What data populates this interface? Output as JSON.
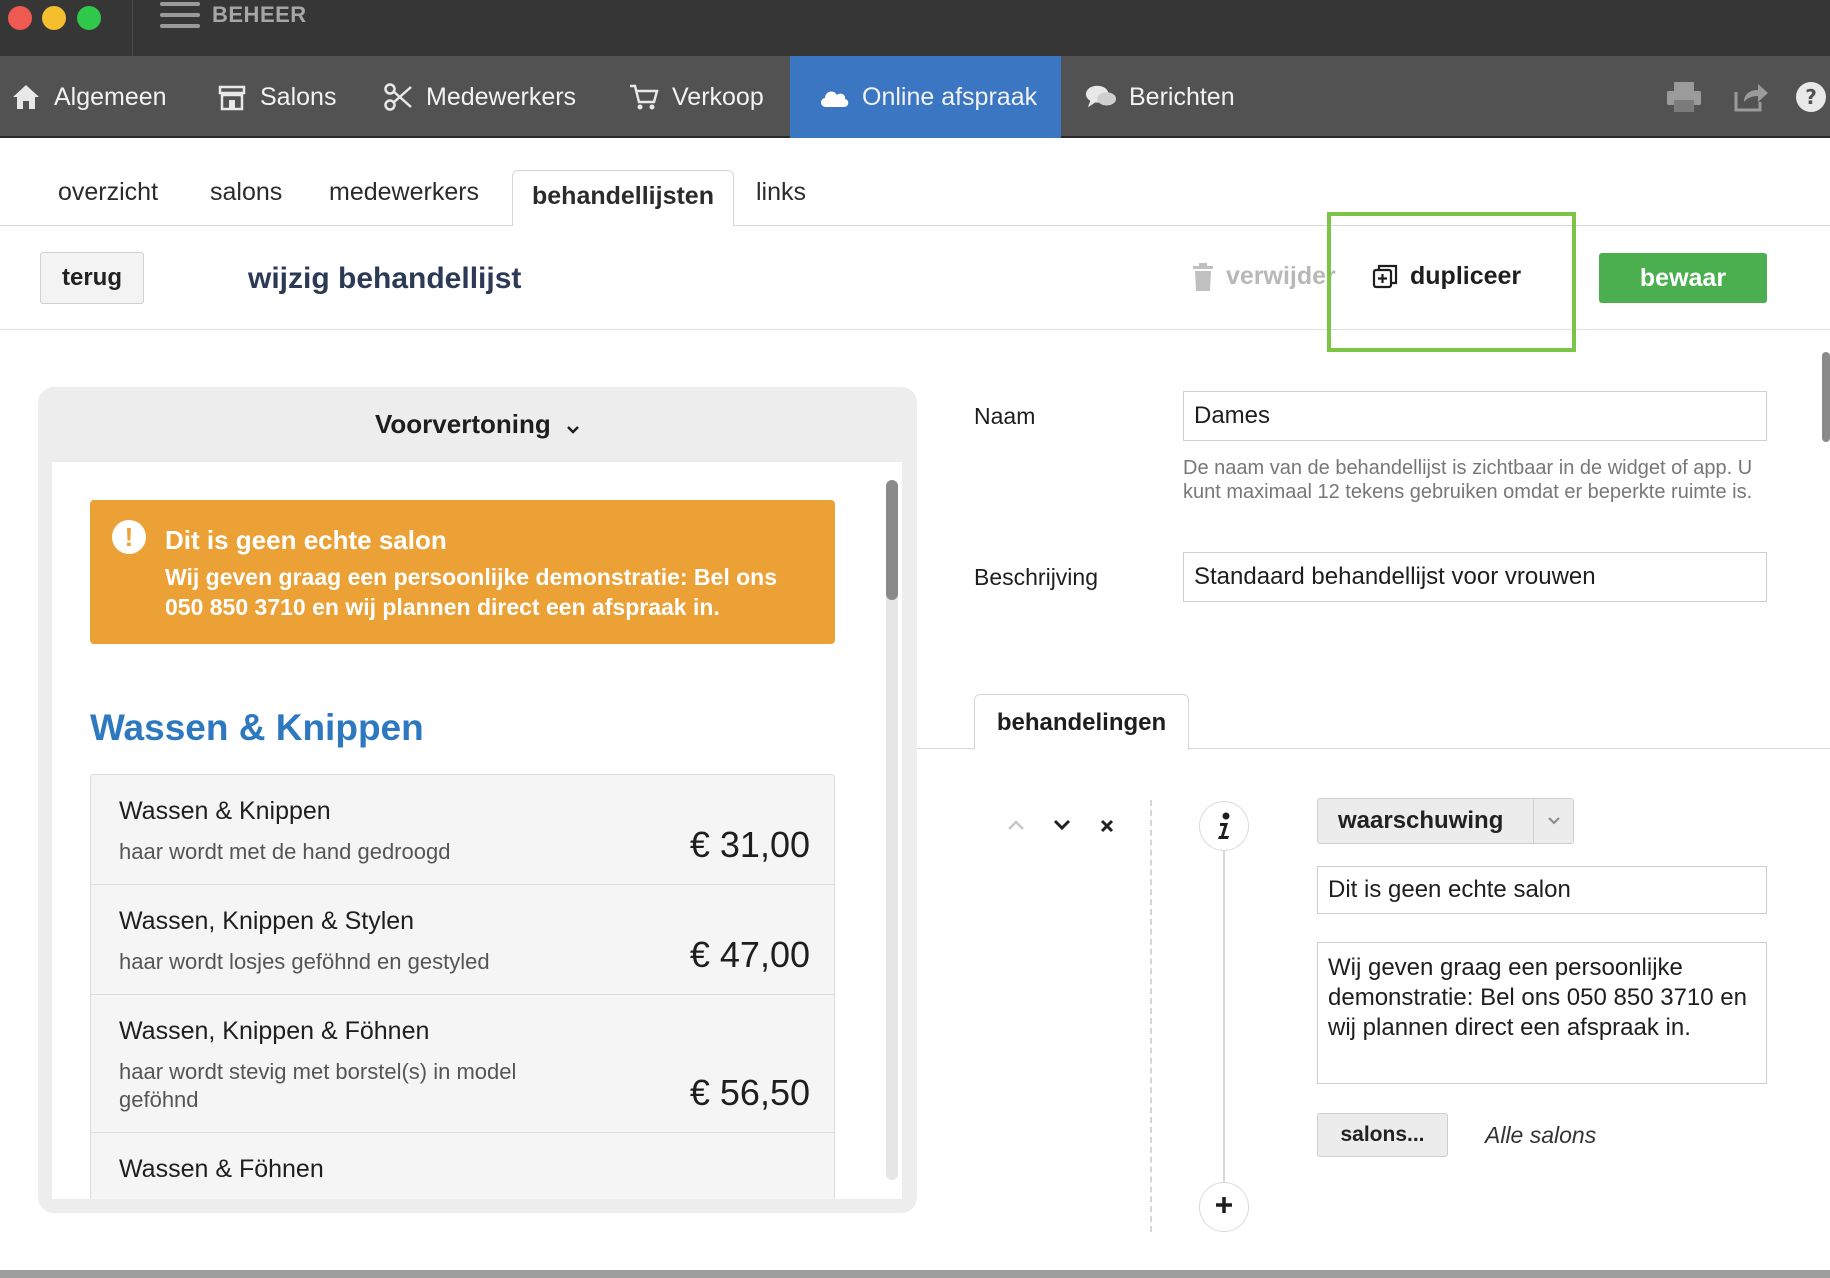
{
  "app": {
    "title": "BEHEER"
  },
  "mainnav": {
    "items": [
      {
        "label": "Algemeen",
        "icon": "home-icon"
      },
      {
        "label": "Salons",
        "icon": "store-icon"
      },
      {
        "label": "Medewerkers",
        "icon": "scissors-icon"
      },
      {
        "label": "Verkoop",
        "icon": "cart-icon"
      },
      {
        "label": "Online afspraak",
        "icon": "cloud-icon",
        "active": true
      },
      {
        "label": "Berichten",
        "icon": "chat-icon"
      }
    ],
    "active_color": "#3b76c2"
  },
  "subtabs": {
    "items": [
      "overzicht",
      "salons",
      "medewerkers",
      "behandellijsten",
      "links"
    ],
    "active": "behandellijsten"
  },
  "toolbar": {
    "back_label": "terug",
    "page_title": "wijzig behandellijst",
    "delete_label": "verwijder",
    "duplicate_label": "dupliceer",
    "save_label": "bewaar",
    "save_color": "#4bae4f",
    "highlight_color": "#7cc446"
  },
  "preview": {
    "header": "Voorvertoning",
    "alert": {
      "title": "Dit is geen echte salon",
      "text": "Wij geven graag een persoonlijke demonstratie: Bel ons 050 850 3710 en wij plannen direct een afspraak in.",
      "color": "#eba136"
    },
    "section_title": "Wassen & Knippen",
    "services": [
      {
        "name": "Wassen & Knippen",
        "desc": "haar wordt met de hand gedroogd",
        "price": "€ 31,00"
      },
      {
        "name": "Wassen, Knippen & Stylen",
        "desc": "haar wordt losjes geföhnd en gestyled",
        "price": "€ 47,00"
      },
      {
        "name": "Wassen, Knippen & Föhnen",
        "desc": "haar wordt stevig met borstel(s) in model geföhnd",
        "price": "€ 56,50"
      },
      {
        "name": "Wassen & Föhnen",
        "desc": "",
        "price": ""
      }
    ]
  },
  "form": {
    "naam_label": "Naam",
    "naam_value": "Dames",
    "naam_help": "De naam van de behandellijst is zichtbaar in de widget of app. U kunt maximaal 12 tekens gebruiken omdat er beperkte ruimte is.",
    "beschrijving_label": "Beschrijving",
    "beschrijving_value": "Standaard behandellijst voor vrouwen"
  },
  "behandelingen": {
    "tab_label": "behandelingen",
    "item": {
      "type_value": "waarschuwing",
      "title_value": "Dit is geen echte salon",
      "text_value": "Wij geven graag een persoonlijke demonstratie: Bel ons 050 850 3710 en wij plannen direct een afspraak in.",
      "salons_button": "salons...",
      "salons_value": "Alle salons"
    }
  }
}
